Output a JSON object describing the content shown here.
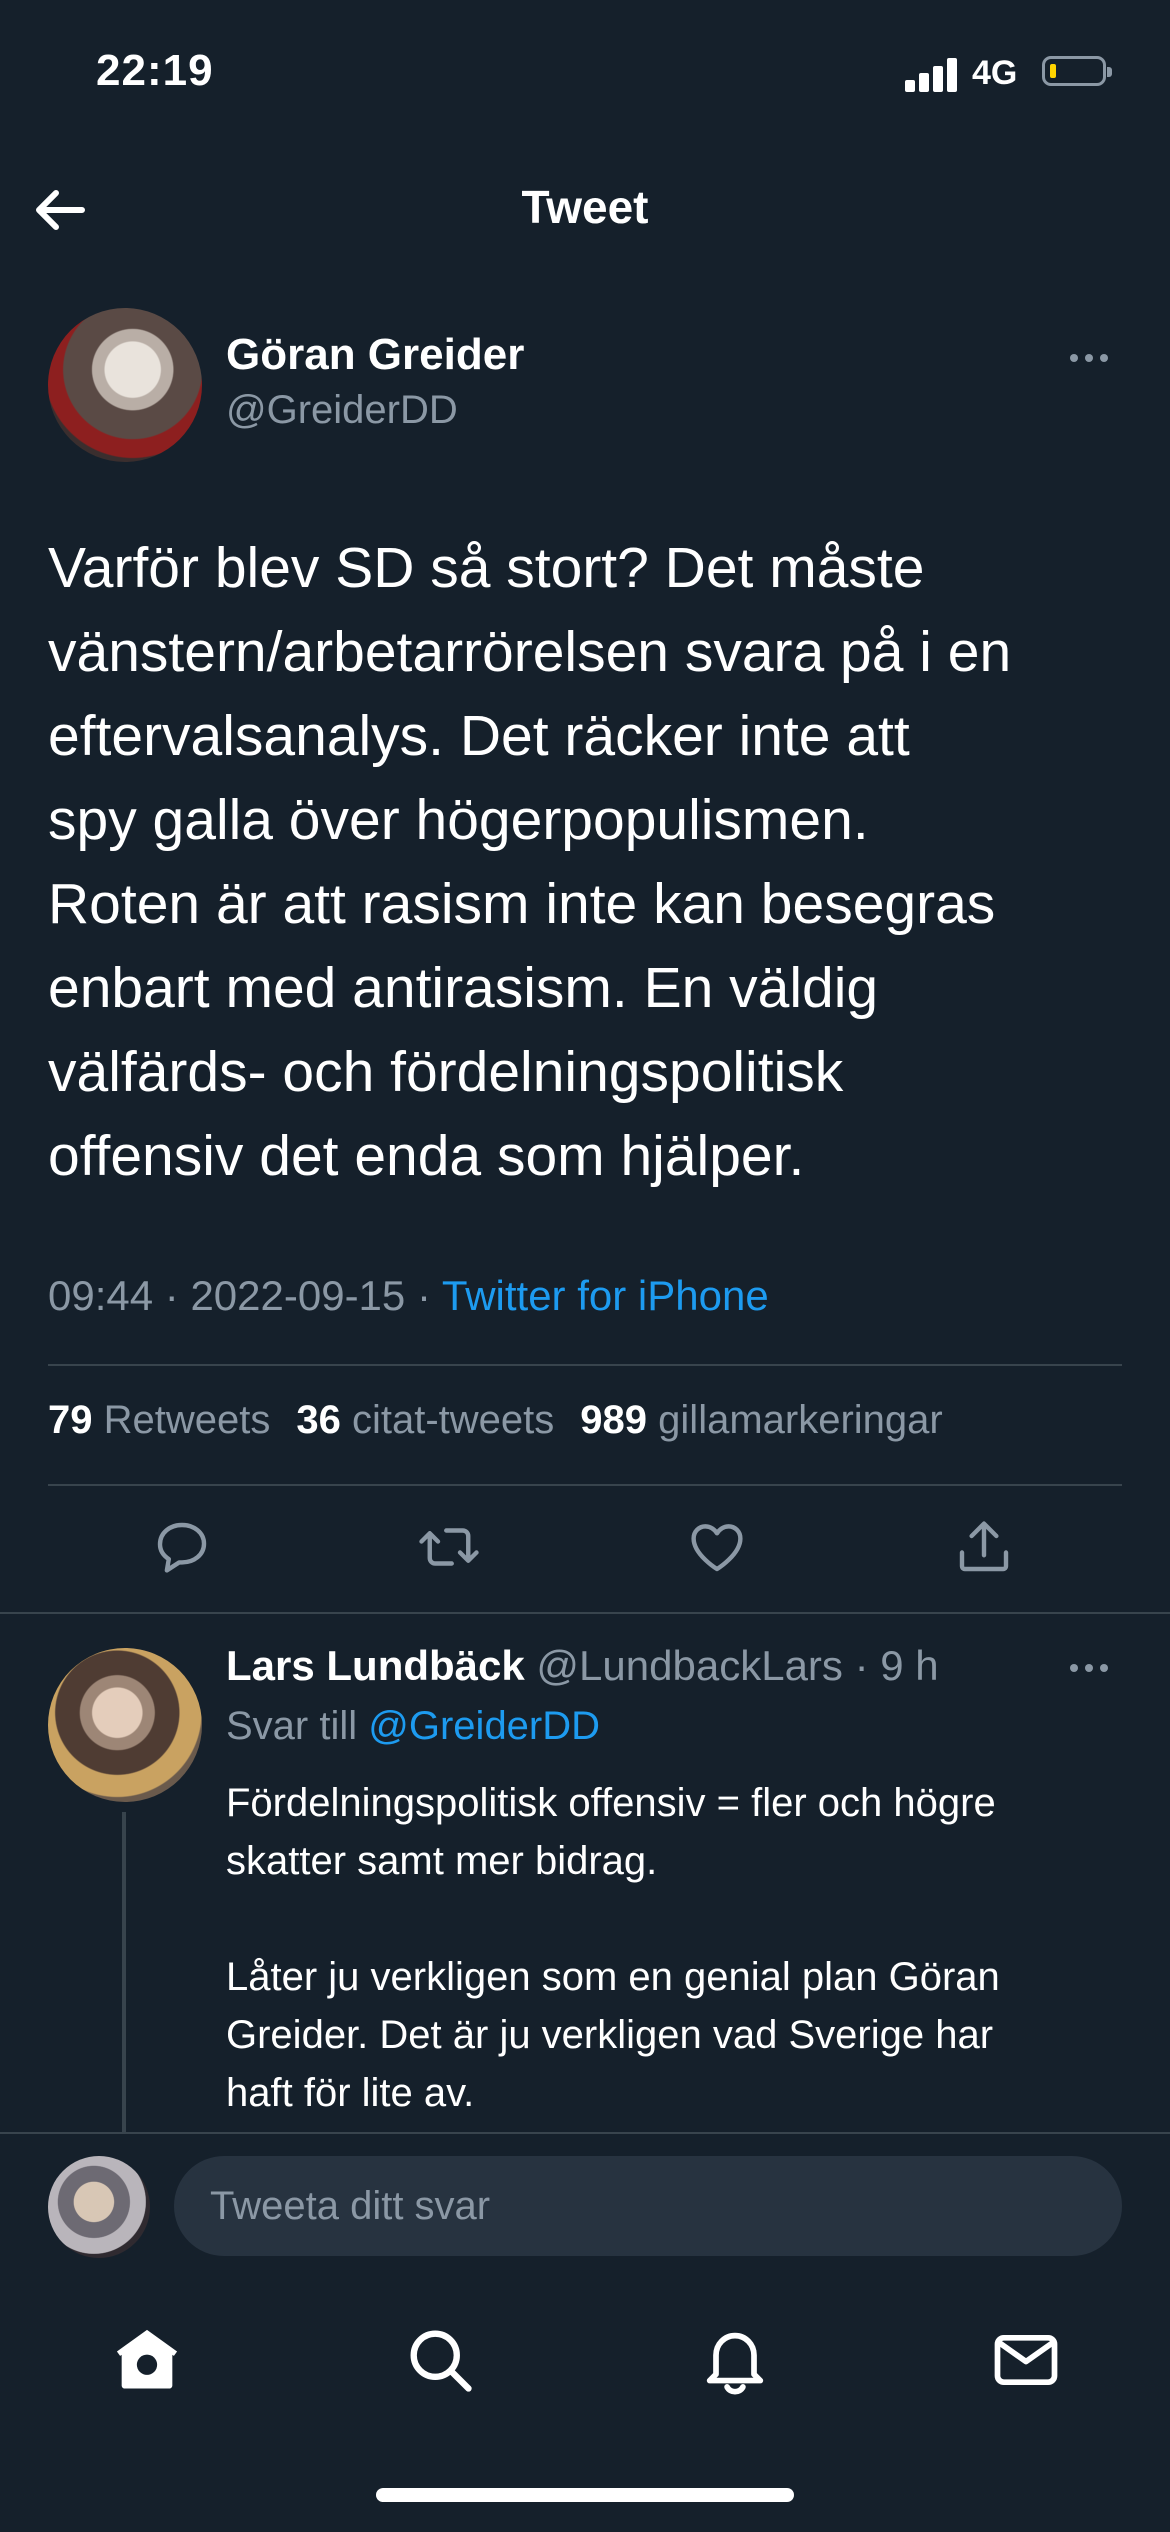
{
  "status": {
    "time": "22:19",
    "network": "4G"
  },
  "header": {
    "title": "Tweet"
  },
  "tweet": {
    "author_name": "Göran Greider",
    "author_handle": "@GreiderDD",
    "text": "Varför blev SD så stort? Det måste\nvänstern/arbetarrörelsen svara på i en\neftervalsanalys. Det räcker inte att\nspy galla över högerpopulismen.\nRoten är att rasism inte kan besegras\nenbart med antirasism. En väldig\nvälfärds- och fördelningspolitisk\noffensiv det enda som hjälper.",
    "time": "09:44",
    "date": "2022-09-15",
    "source": "Twitter for iPhone",
    "retweets_count": "79",
    "retweets_label": "Retweets",
    "quotes_count": "36",
    "quotes_label": "citat-tweets",
    "likes_count": "989",
    "likes_label": "gillamarkeringar"
  },
  "reply": {
    "author_name": "Lars Lundbäck",
    "author_handle": "@LundbackLars",
    "age": "9 h",
    "reply_to_prefix": "Svar till",
    "reply_to_handle": "@GreiderDD",
    "text": "Fördelningspolitisk offensiv = fler och högre\nskatter samt mer bidrag.\n\nLåter ju verkligen som en genial plan Göran\nGreider. Det är ju verkligen vad Sverige har\nhaft för lite av."
  },
  "compose": {
    "placeholder": "Tweeta ditt svar"
  },
  "colors": {
    "background": "#15202b",
    "accent": "#1d9bf0",
    "muted": "#8b98a5",
    "divider": "#38444d"
  },
  "icons": {
    "actions": [
      "reply-icon",
      "retweet-icon",
      "like-icon",
      "share-icon"
    ],
    "tabs": [
      "home-icon",
      "search-icon",
      "notifications-icon",
      "messages-icon"
    ]
  }
}
